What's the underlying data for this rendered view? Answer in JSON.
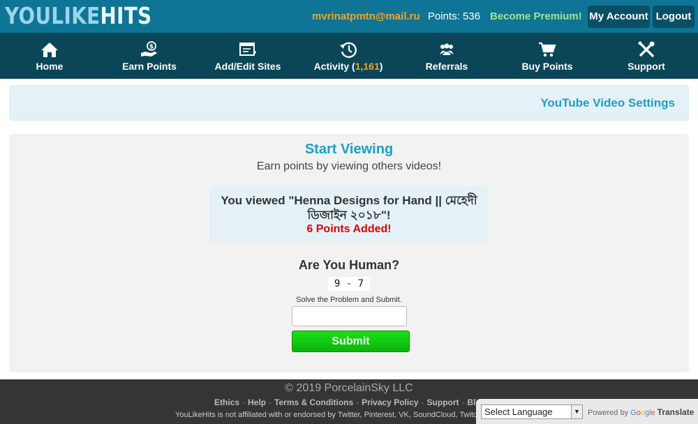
{
  "header": {
    "logo_part1": "YOULIKE",
    "logo_part2": "HITS",
    "email": "mvrinatpmtn@mail.ru",
    "points_text": "Points: 536",
    "premium": "Become Premium!",
    "my_account": "My Account",
    "logout": "Logout"
  },
  "nav": {
    "items": [
      {
        "label": "Home",
        "icon": "home-icon"
      },
      {
        "label": "Earn Points",
        "icon": "hand-coin-icon"
      },
      {
        "label": "Add/Edit Sites",
        "icon": "edit-list-icon"
      },
      {
        "label": "Activity (",
        "count": "1,161",
        "suffix": ")",
        "icon": "history-icon"
      },
      {
        "label": "Referrals",
        "icon": "people-icon"
      },
      {
        "label": "Buy Points",
        "icon": "cart-icon"
      },
      {
        "label": "Support",
        "icon": "tools-icon"
      }
    ]
  },
  "settings": {
    "link": "YouTube Video Settings"
  },
  "main": {
    "heading": "Start Viewing",
    "subheading": "Earn points by viewing others videos!",
    "viewed_message": "You viewed \"Henna Designs for Hand || মেহেদী ডিজাইন ২০১৮\"!",
    "points_added": "6 Points Added!",
    "human_heading": "Are You Human?",
    "captcha_a": "9",
    "captcha_op": "-",
    "captcha_b": "7",
    "solve_text": "Solve the Problem and Submit.",
    "answer_value": "",
    "submit": "Submit"
  },
  "footer": {
    "copyright": "© 2019 PorcelainSky LLC",
    "links": [
      "Ethics",
      "Help",
      "Terms & Conditions",
      "Privacy Policy",
      "Support",
      "Blo"
    ],
    "disclaimer": "YouLikeHits is not affiliated with or endorsed by Twitter, Pinterest, VK, SoundCloud, Twitc"
  },
  "translate": {
    "select_label": "Select Language",
    "powered_by": "Powered by",
    "google_letters": [
      "G",
      "o",
      "o",
      "g",
      "l",
      "e"
    ],
    "translate_label": "Translate"
  },
  "colors": {
    "topbar": "#0f7596",
    "navbar": "#0a4657",
    "accent": "#1d9ec4",
    "email": "#f2a427",
    "premium": "#9fe88e",
    "points_added": "#e00000",
    "submit": "#0bb50b"
  }
}
